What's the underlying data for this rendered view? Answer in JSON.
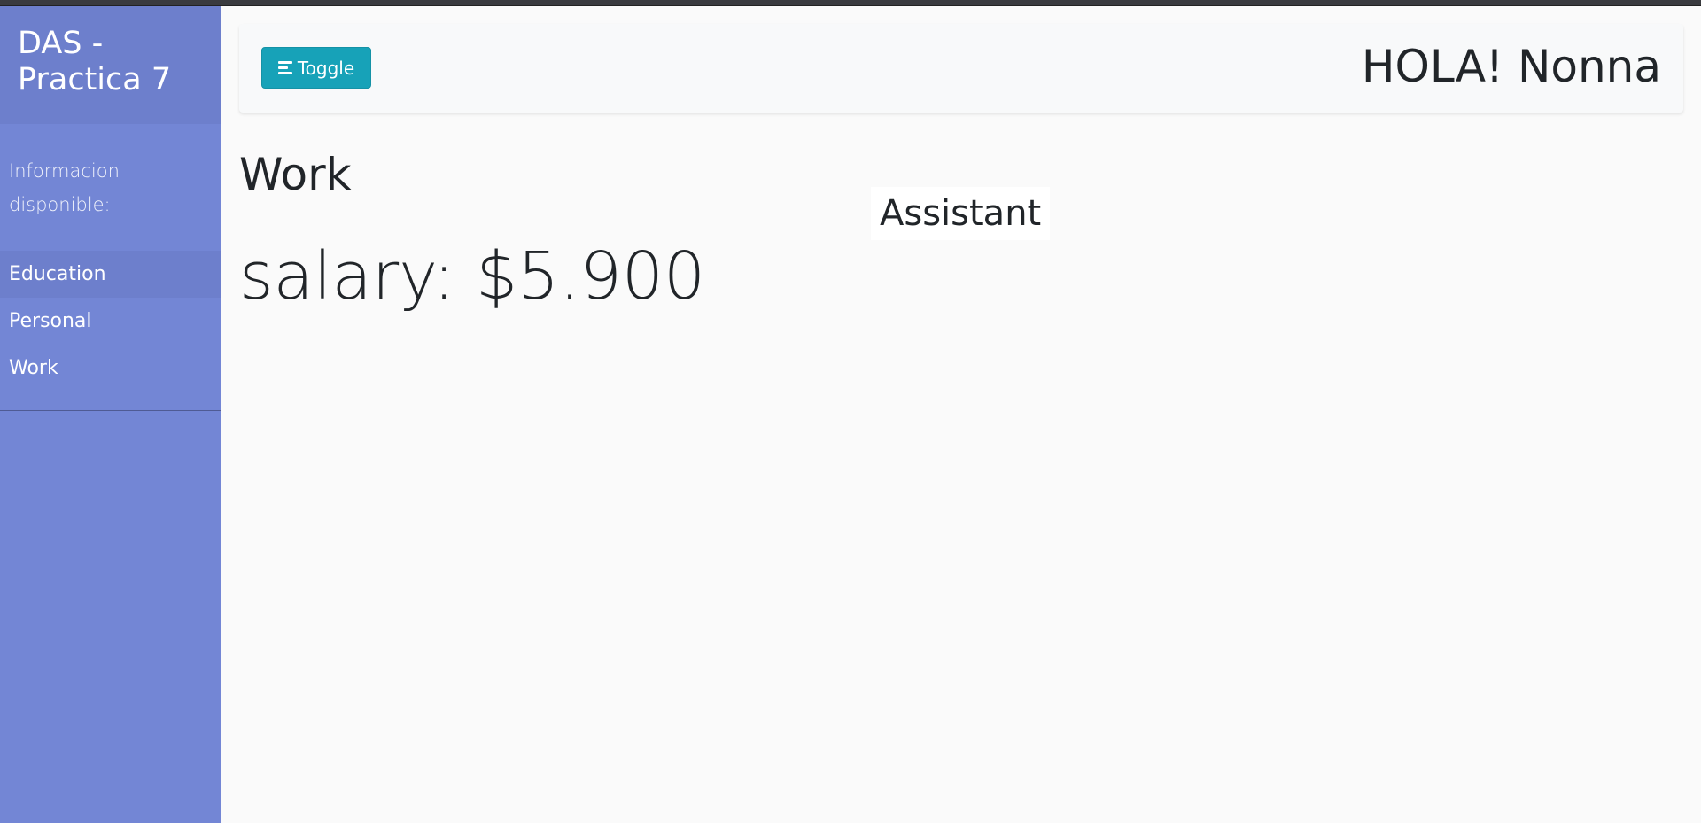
{
  "sidebar": {
    "title": "DAS - Practica 7",
    "caption": "Informacion disponible:",
    "items": [
      {
        "label": "Education",
        "active": true
      },
      {
        "label": "Personal",
        "active": false
      },
      {
        "label": "Work",
        "active": false
      }
    ]
  },
  "navbar": {
    "toggle_label": "Toggle",
    "toggle_icon": "align-left-icon",
    "greeting": "HOLA! Nonna"
  },
  "main": {
    "section_title": "Work",
    "role": "Assistant",
    "salary_text": "salary: $5.900"
  },
  "colors": {
    "sidebar_bg": "#7386d5",
    "sidebar_header_bg": "#6d7fcc",
    "toggle_bg": "#17a2b8",
    "page_bg": "#fafafa",
    "text": "#212529"
  }
}
